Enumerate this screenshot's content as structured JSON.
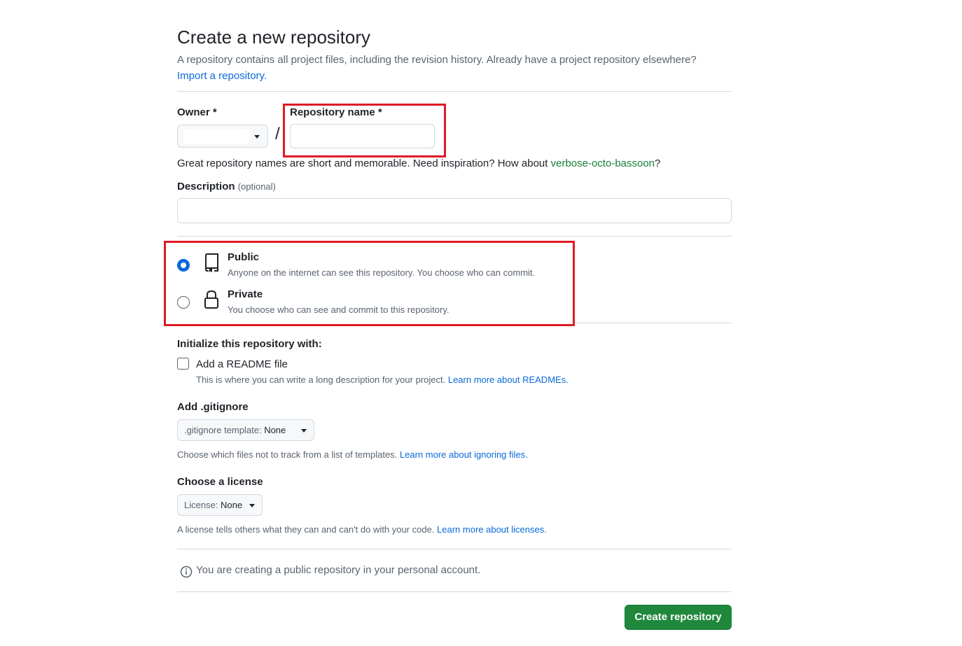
{
  "header": {
    "title": "Create a new repository",
    "subtitle": "A repository contains all project files, including the revision history. Already have a project repository elsewhere?",
    "import_link": "Import a repository."
  },
  "owner": {
    "label": "Owner *",
    "value": ""
  },
  "repo_name": {
    "label": "Repository name *",
    "value": "",
    "hint_prefix": "Great repository names are short and memorable. Need inspiration? How about ",
    "suggestion": "verbose-octo-bassoon",
    "hint_suffix": "?"
  },
  "separator": "/",
  "description": {
    "label": "Description",
    "optional": "(optional)",
    "value": ""
  },
  "visibility": {
    "public": {
      "title": "Public",
      "desc": "Anyone on the internet can see this repository. You choose who can commit.",
      "selected": true
    },
    "private": {
      "title": "Private",
      "desc": "You choose who can see and commit to this repository.",
      "selected": false
    }
  },
  "init": {
    "heading": "Initialize this repository with:",
    "readme_label": "Add a README file",
    "readme_desc": "This is where you can write a long description for your project. ",
    "readme_link": "Learn more about READMEs."
  },
  "gitignore": {
    "heading": "Add .gitignore",
    "dropdown_prefix": ".gitignore template: ",
    "dropdown_value": "None",
    "desc": "Choose which files not to track from a list of templates. ",
    "link": "Learn more about ignoring files."
  },
  "license": {
    "heading": "Choose a license",
    "dropdown_prefix": "License: ",
    "dropdown_value": "None",
    "desc": "A license tells others what they can and can't do with your code. ",
    "link": "Learn more about licenses."
  },
  "notice": "You are creating a public repository in your personal account.",
  "submit_label": "Create repository",
  "colors": {
    "primary": "#1f883d",
    "link": "#0969da",
    "highlight": "#e01b24"
  }
}
